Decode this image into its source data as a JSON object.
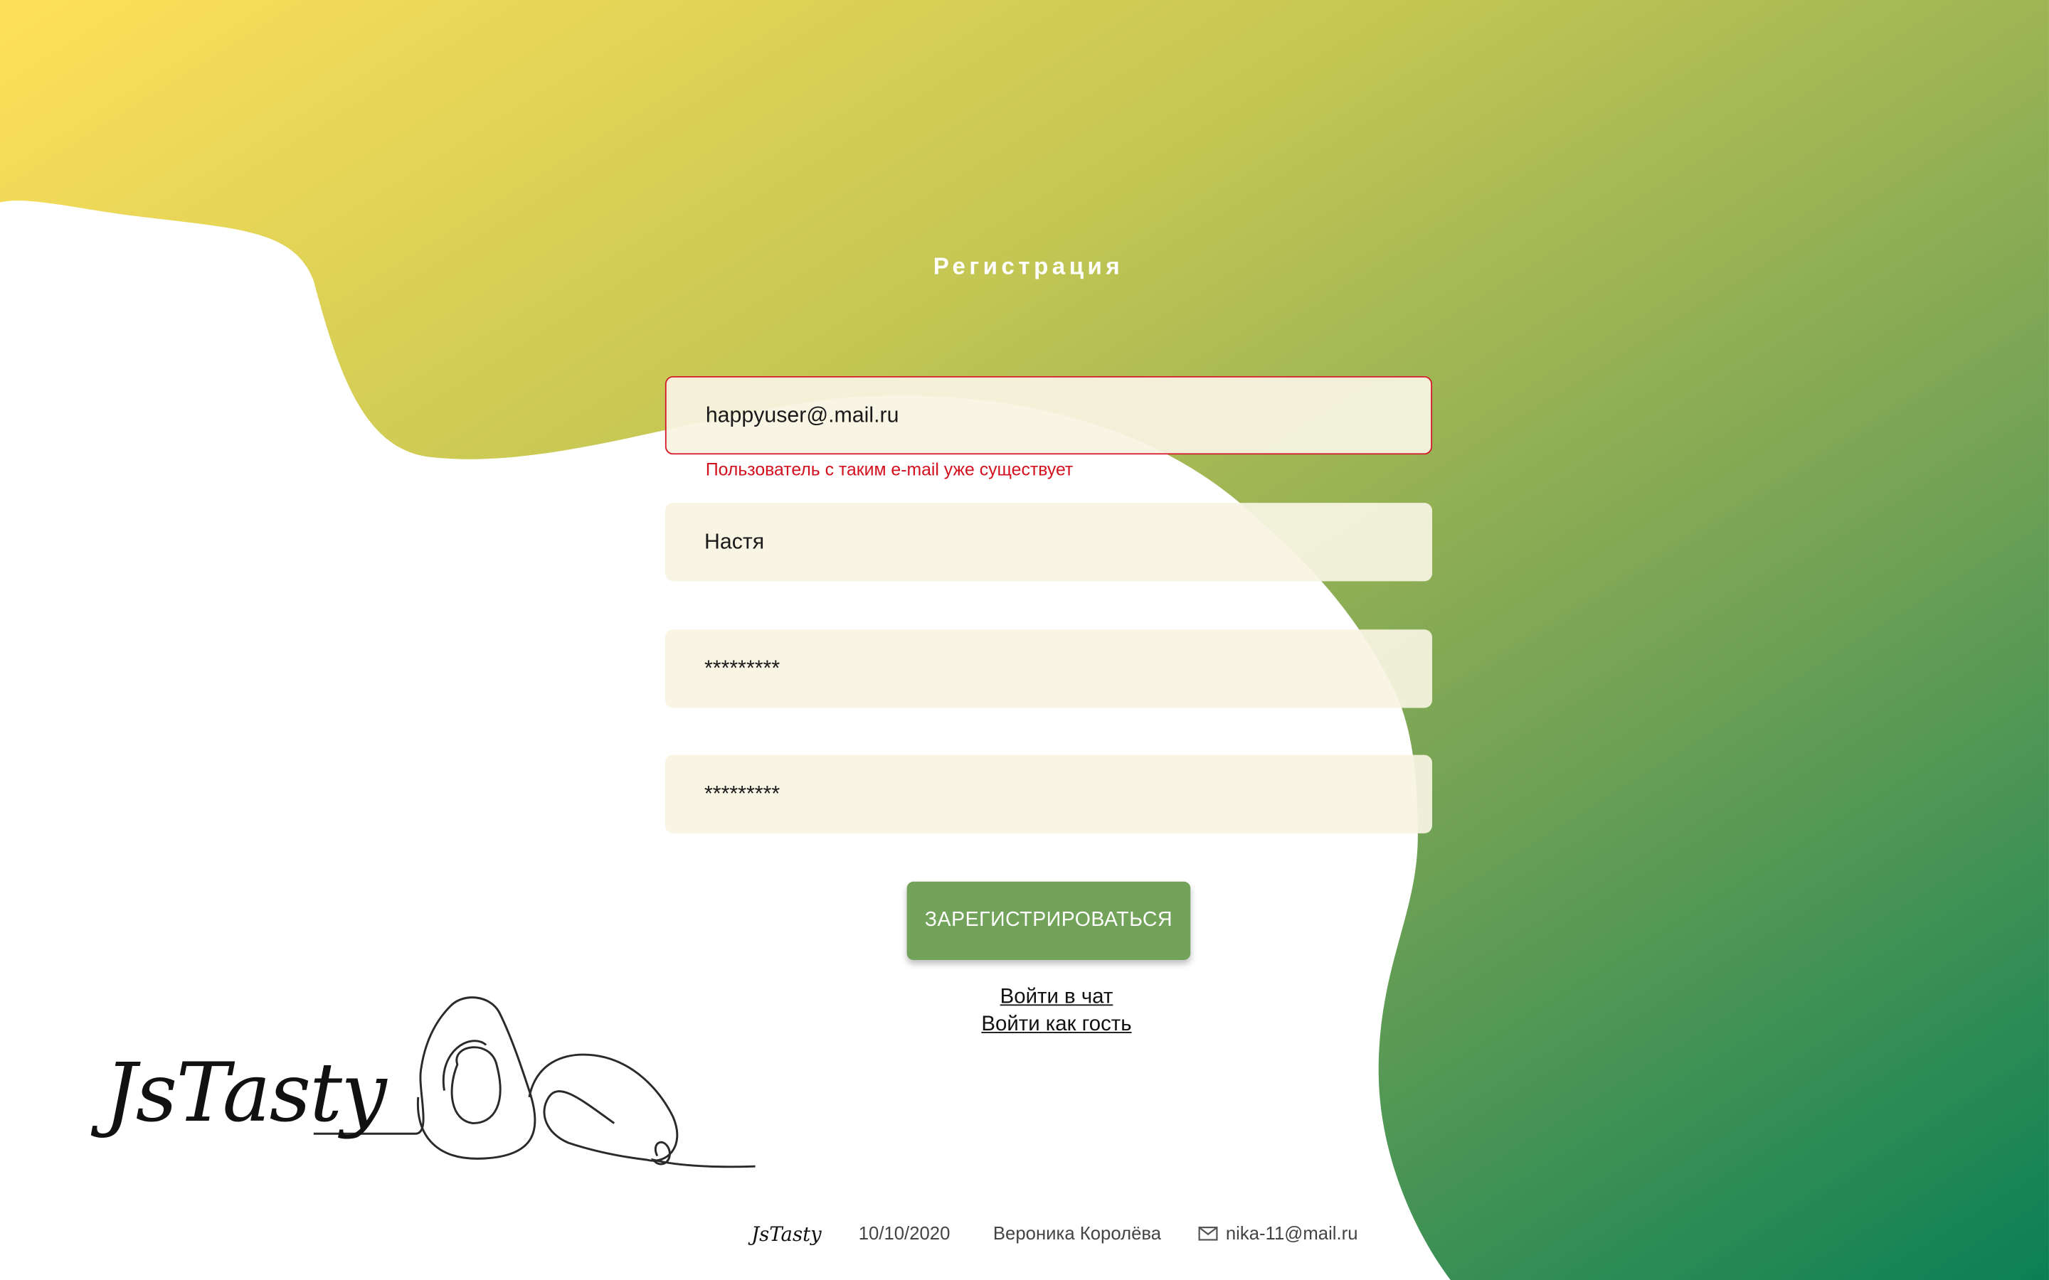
{
  "page": {
    "title": "Регистрация"
  },
  "form": {
    "email_value": "happyuser@.mail.ru",
    "email_error": "Пользователь с таким e-mail уже существует",
    "name_value": "Настя",
    "password_value": "*********",
    "password_confirm_value": "*********",
    "submit_label": "ЗАРЕГИСТРИРОВАТЬСЯ"
  },
  "links": {
    "login_chat": "Войти в чат",
    "login_guest": "Войти как гость"
  },
  "brand": {
    "logo_text": "JsTasty"
  },
  "footer": {
    "logo_text": "JsTasty",
    "date": "10/10/2020",
    "author": "Вероника Королёва",
    "email": "nika-11@mail.ru",
    "email_icon": "mail-icon"
  },
  "colors": {
    "gradient_start": "#ffe05a",
    "gradient_mid": "#a7b955",
    "gradient_end": "#0b8055",
    "error": "#d2101e",
    "button": "#73a35a",
    "field_bg": "#f8f4e2"
  }
}
